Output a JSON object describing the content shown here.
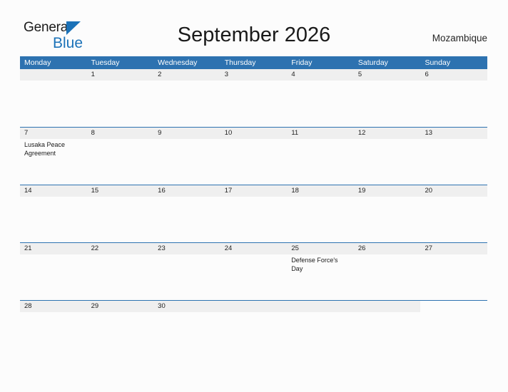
{
  "brand": {
    "name_part1": "General",
    "name_part2": "Blue",
    "triangle_color": "#1b72b8",
    "accent_color": "#2d72b0"
  },
  "header": {
    "title": "September 2026",
    "country": "Mozambique"
  },
  "calendar": {
    "month": "September",
    "year": "2026",
    "weekday_headers": [
      "Monday",
      "Tuesday",
      "Wednesday",
      "Thursday",
      "Friday",
      "Saturday",
      "Sunday"
    ],
    "header_bg": "#2d72b0",
    "band_bg": "#efefef",
    "weeks": [
      {
        "band_columns": 7,
        "days": [
          {
            "number": "",
            "events": []
          },
          {
            "number": "1",
            "events": []
          },
          {
            "number": "2",
            "events": []
          },
          {
            "number": "3",
            "events": []
          },
          {
            "number": "4",
            "events": []
          },
          {
            "number": "5",
            "events": []
          },
          {
            "number": "6",
            "events": []
          }
        ]
      },
      {
        "band_columns": 7,
        "days": [
          {
            "number": "7",
            "events": [
              "Lusaka Peace Agreement"
            ]
          },
          {
            "number": "8",
            "events": []
          },
          {
            "number": "9",
            "events": []
          },
          {
            "number": "10",
            "events": []
          },
          {
            "number": "11",
            "events": []
          },
          {
            "number": "12",
            "events": []
          },
          {
            "number": "13",
            "events": []
          }
        ]
      },
      {
        "band_columns": 7,
        "days": [
          {
            "number": "14",
            "events": []
          },
          {
            "number": "15",
            "events": []
          },
          {
            "number": "16",
            "events": []
          },
          {
            "number": "17",
            "events": []
          },
          {
            "number": "18",
            "events": []
          },
          {
            "number": "19",
            "events": []
          },
          {
            "number": "20",
            "events": []
          }
        ]
      },
      {
        "band_columns": 7,
        "days": [
          {
            "number": "21",
            "events": []
          },
          {
            "number": "22",
            "events": []
          },
          {
            "number": "23",
            "events": []
          },
          {
            "number": "24",
            "events": []
          },
          {
            "number": "25",
            "events": [
              "Defense Force's Day"
            ]
          },
          {
            "number": "26",
            "events": []
          },
          {
            "number": "27",
            "events": []
          }
        ]
      },
      {
        "band_columns": 6,
        "days": [
          {
            "number": "28",
            "events": []
          },
          {
            "number": "29",
            "events": []
          },
          {
            "number": "30",
            "events": []
          },
          {
            "number": "",
            "events": []
          },
          {
            "number": "",
            "events": []
          },
          {
            "number": "",
            "events": []
          },
          {
            "number": "",
            "events": []
          }
        ]
      }
    ]
  }
}
